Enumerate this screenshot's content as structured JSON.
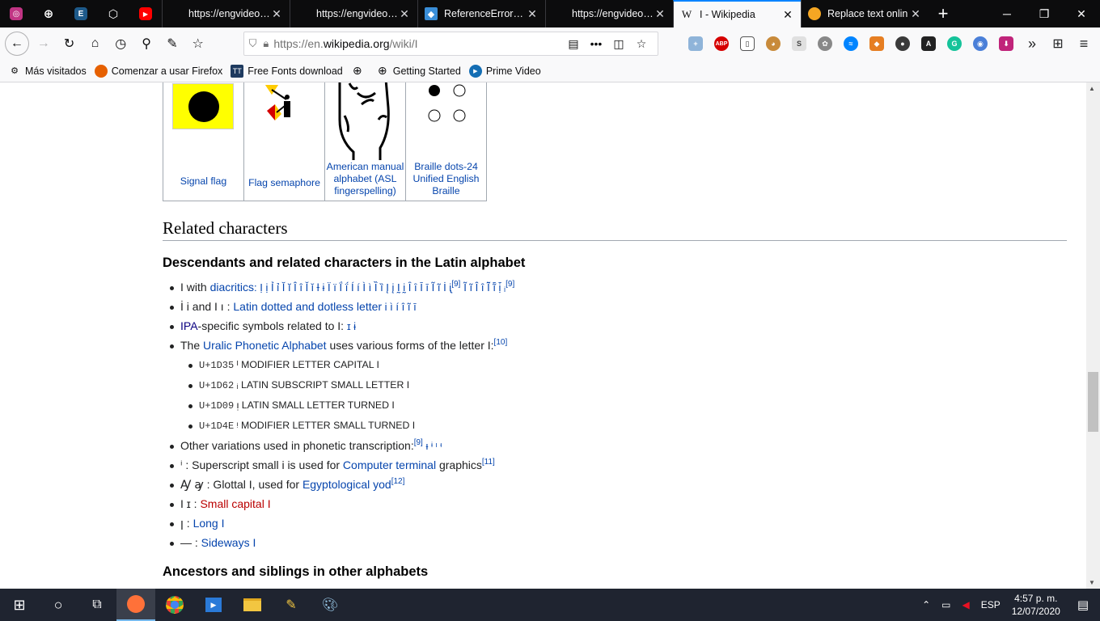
{
  "tabs": [
    {
      "title": "https://engvideo.pro/c"
    },
    {
      "title": "https://engvideo.pro/c"
    },
    {
      "title": "ReferenceError: \"x"
    },
    {
      "title": "https://engvideo.pro/c"
    },
    {
      "title": "I - Wikipedia"
    },
    {
      "title": "Replace text onlin"
    }
  ],
  "url": {
    "prefix": "https://en.",
    "domain": "wikipedia.org",
    "path": "/wiki/I"
  },
  "bookmarks": [
    "Más visitados",
    "Comenzar a usar Firefox",
    "Free Fonts download",
    "Getting Started",
    "Prime Video"
  ],
  "signs": [
    {
      "label": "Signal flag"
    },
    {
      "label": "Flag semaphore"
    },
    {
      "label": "American manual alphabet (ASL fingerspelling)"
    },
    {
      "label": "Braille dots-24 Unified English Braille"
    }
  ],
  "section_title": "Related characters",
  "subsection1": "Descendants and related characters in the Latin alphabet",
  "subsection2": "Ancestors and siblings in other alphabets",
  "items": {
    "i1_pre": "I with ",
    "i1_link": "diacritics",
    "i1_sym": ": Ị ị Ỉ ỉ Ĭ ĭ Î î Ǐ ǐ Ɨ ɨ Ï ï Ḯ ḯ Í í Ì ì Ȉ ȉ Į į Ḭ ḭ Ȋ ȋ Ī ī Ĩ ĩ İ ᶖ",
    "i1_sup": "[9]",
    "i1_sym2": "Ĩ ĩ Î î Ĩ̄ ĩ̄ ị̄ ᵢ",
    "i1_sup2": "[9]",
    "i2_pre": "İ i and I ı : ",
    "i2_link": "Latin dotted and dotless letter",
    "i2_sym": " i ì í î ĩ ī",
    "i3_link": "IPA",
    "i3_text": "-specific symbols related to I: ",
    "i3_sym": "ɪ ɨ",
    "i4_pre": "The ",
    "i4_link": "Uralic Phonetic Alphabet",
    "i4_text": " uses various forms of the letter I:",
    "i4_sup": "[10]",
    "u1_code": "U+1D35",
    "u1_sym": "ᴵ",
    "u1_name": "MODIFIER LETTER CAPITAL I",
    "u2_code": "U+1D62",
    "u2_sym": "ᵢ",
    "u2_name": "LATIN SUBSCRIPT SMALL LETTER I",
    "u3_code": "U+1D09",
    "u3_sym": "ᴉ",
    "u3_name": "LATIN SMALL LETTER TURNED I",
    "u4_code": "U+1D4E",
    "u4_sym": "ᵎ",
    "u4_name": "MODIFIER LETTER SMALL TURNED I",
    "i5_text": "Other variations used in phonetic transcription:",
    "i5_sup": "[9]",
    "i5_sym": " ᵻ ᶤ ᶦ ᶧ",
    "i6_sym": "ⁱ",
    "i6_text": " : Superscript small i is used for ",
    "i6_link": "Computer terminal",
    "i6_text2": " graphics",
    "i6_sup": "[11]",
    "i7_sym": "Ꜽ ꜽ",
    "i7_text": " : Glottal I, used for ",
    "i7_link": "Egyptological yod",
    "i7_sup": "[12]",
    "i8_sym": "I ɪ",
    "i8_text": " : ",
    "i8_link": "Small capital I",
    "i9_sym": "ꞁ",
    "i9_text": " : ",
    "i9_link": "Long I",
    "i10_sym": "—",
    "i10_text": " : ",
    "i10_link": "Sideways I"
  },
  "tray": {
    "lang": "ESP",
    "time": "4:57 p. m.",
    "date": "12/07/2020"
  }
}
